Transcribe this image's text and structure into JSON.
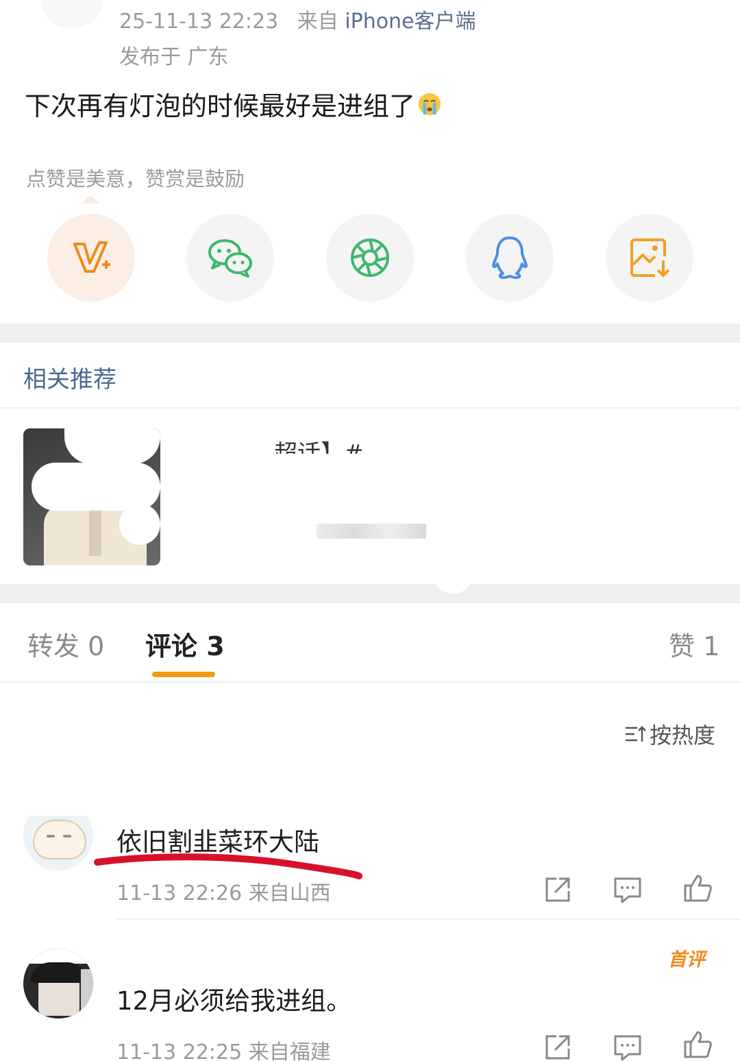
{
  "post": {
    "time": "25-11-13 22:23",
    "from_prefix": "来自",
    "source": "iPhone客户端",
    "location": "发布于 广东",
    "text": "下次再有灯泡的时候最好是进组了"
  },
  "reward": {
    "tip": "点赞是美意，赞赏是鼓励"
  },
  "share": {
    "items": [
      {
        "icon": "vip-plus-icon"
      },
      {
        "icon": "wechat-icon"
      },
      {
        "icon": "moments-icon"
      },
      {
        "icon": "qq-icon"
      },
      {
        "icon": "save-image-icon"
      }
    ]
  },
  "recommend": {
    "title": "相关推荐",
    "item_title": "超话】#"
  },
  "tabs": [
    {
      "label": "转发 0"
    },
    {
      "label": "评论 3",
      "active": true
    },
    {
      "label": "赞 1"
    }
  ],
  "sort": {
    "label": "按热度"
  },
  "comments": [
    {
      "text": "依旧割韭菜环大陆",
      "meta": "11-13 22:26 来自山西"
    },
    {
      "text": "12月必须给我进组。",
      "meta": "11-13 22:25 来自福建",
      "badge": "首评"
    }
  ],
  "colors": {
    "accent": "#f39c12",
    "link_blue": "#4b6a8f",
    "wechat_green": "#3fb76b",
    "qq_blue": "#4a90e2",
    "save_orange": "#f0a020",
    "vip_orange": "#f08a1c",
    "annotation_red": "#d8102a"
  }
}
